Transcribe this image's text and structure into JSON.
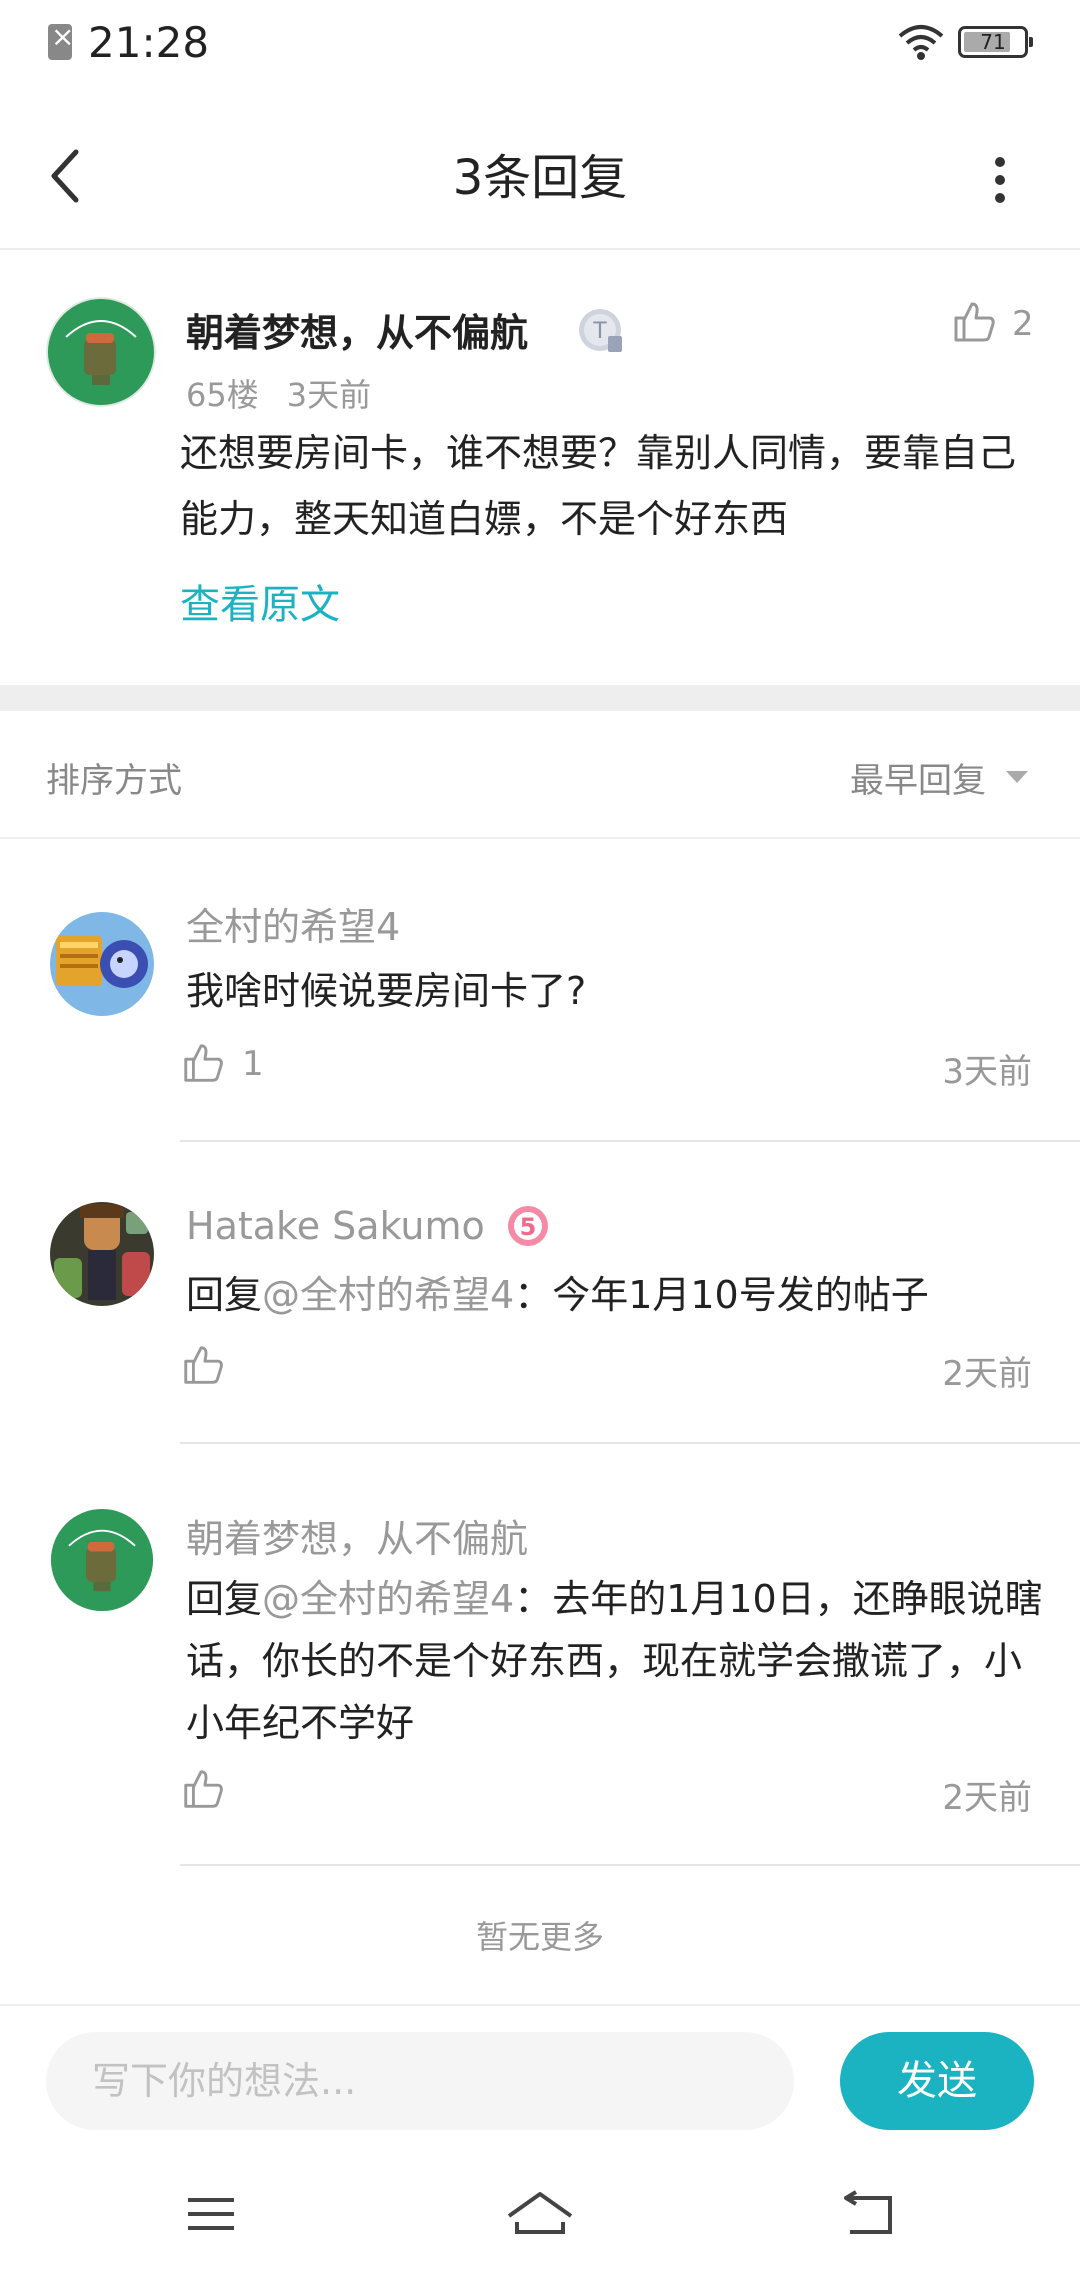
{
  "status_bar": {
    "time": "21:28",
    "battery": "71"
  },
  "header": {
    "title": "3条回复"
  },
  "post": {
    "username": "朝着梦想，从不偏航",
    "level_badge": "T",
    "floor": "65楼",
    "time": "3天前",
    "likes": "2",
    "body": "还想要房间卡，谁不想要？靠别人同情，要靠自己能力，整天知道白嫖，不是个好东西",
    "view_original": "查看原文"
  },
  "sort": {
    "label": "排序方式",
    "value": "最早回复"
  },
  "replies": [
    {
      "username": "全村的希望4",
      "text": "我啥时候说要房间卡了?",
      "likes": "1",
      "time": "3天前"
    },
    {
      "username": "Hatake Sakumo",
      "badge": "5",
      "reply_prefix": "回复",
      "reply_to": "@全村的希望4",
      "text": "：今年1月10号发的帖子",
      "likes": "",
      "time": "2天前"
    },
    {
      "username": "朝着梦想，从不偏航",
      "reply_prefix": "回复",
      "reply_to": "@全村的希望4",
      "text": "：去年的1月10日，还睁眼说瞎话，你长的不是个好东西，现在就学会撒谎了，小小年纪不学好",
      "likes": "",
      "time": "2天前"
    }
  ],
  "footer_note": "暂无更多",
  "input": {
    "placeholder": "写下你的想法...",
    "send_label": "发送"
  },
  "colors": {
    "accent": "#1bb3c2",
    "muted": "#999999",
    "divider": "#eeeeee"
  }
}
